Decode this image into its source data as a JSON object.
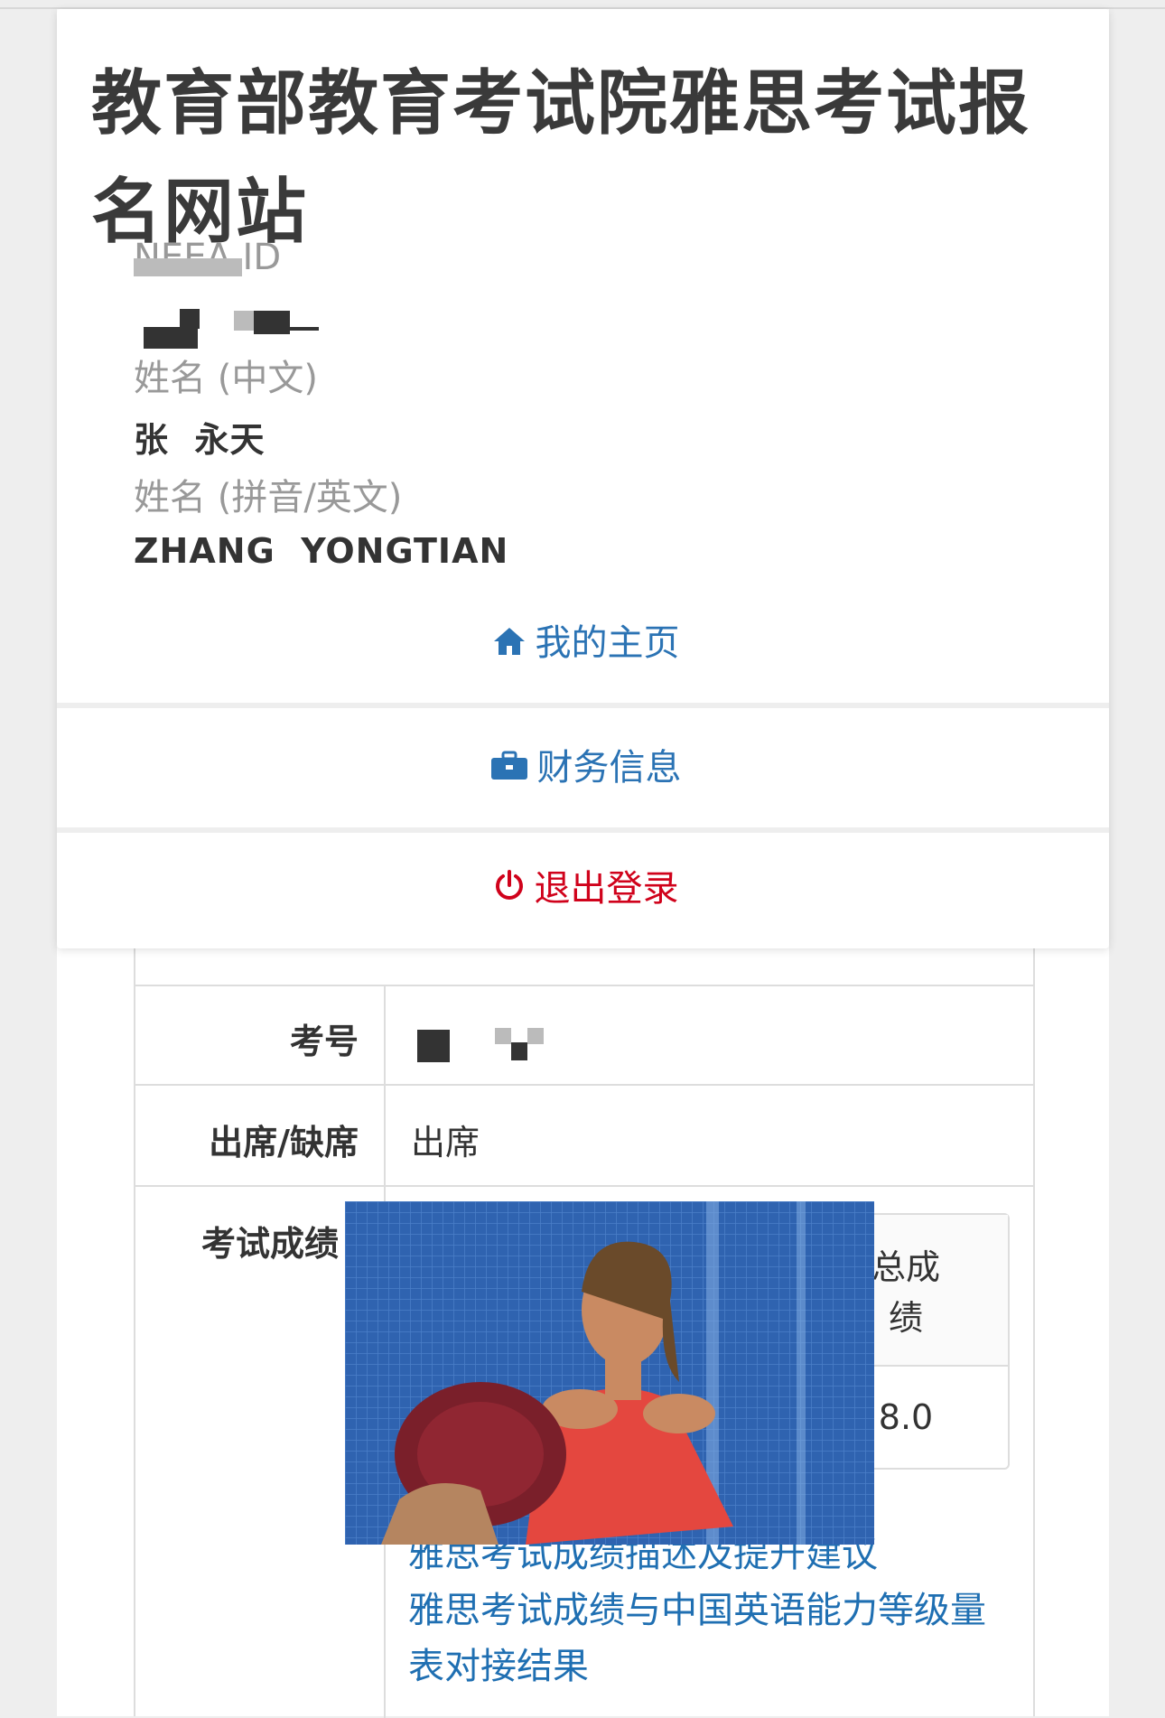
{
  "site_title": "教育部教育考试院雅思考试报名网站",
  "profile": {
    "neea_id_label": "NEEA ID",
    "name_cn_label": "姓名 (中文)",
    "name_cn_value": "张  永天",
    "name_en_label": "姓名 (拼音/英文)",
    "name_en_value": "ZHANG  YONGTIAN"
  },
  "menu": {
    "home": "我的主页",
    "finance": "财务信息",
    "logout": "退出登录"
  },
  "table": {
    "exam_no_label": "考号",
    "attendance_label": "出席/缺席",
    "attendance_value": "出席",
    "scores_label": "考试成绩",
    "overall_label": "总成绩",
    "overall_value": "8.0"
  },
  "links": {
    "desc": "雅思考试成绩描述及提升建议",
    "cse": "雅思考试成绩与中国英语能力等级量表对接结果"
  },
  "colors": {
    "link_blue": "#2b73b4",
    "logout_red": "#d0021b"
  },
  "icons": [
    "home-icon",
    "briefcase-icon",
    "power-icon"
  ]
}
